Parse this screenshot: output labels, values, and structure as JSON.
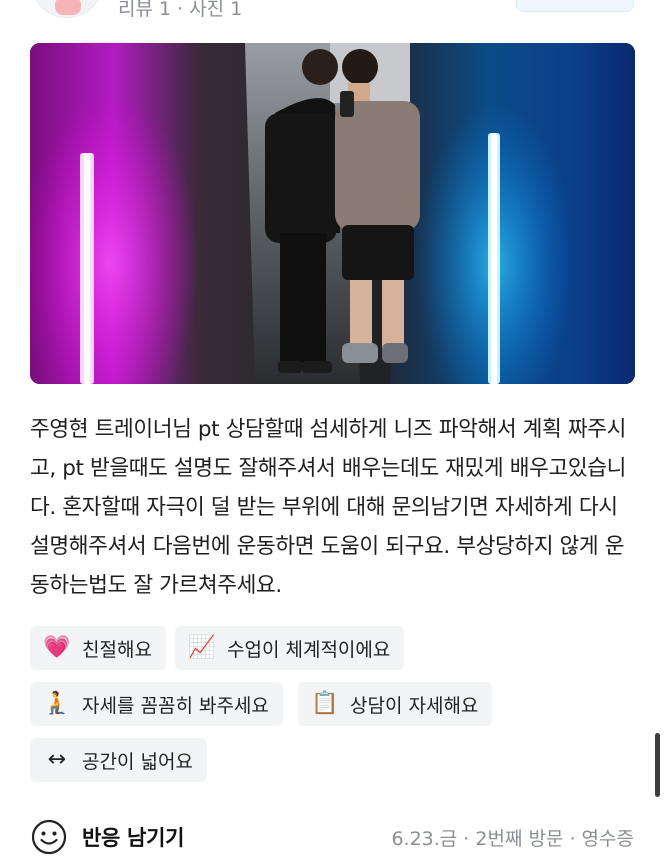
{
  "header": {
    "meta": "리뷰 1 · 사진 1"
  },
  "photo": {
    "alt": "",
    "colors": {
      "left_light": "#e020e0",
      "right_light": "#1aa8ff"
    }
  },
  "review": {
    "text": "주영현 트레이너님 pt 상담할때 섬세하게 니즈 파악해서 계획 짜주시고, pt 받을때도 설명도 잘해주셔서 배우는데도 재밌게 배우고있습니다. 혼자할때 자극이 덜 받는 부위에 대해 문의남기면 자세하게 다시 설명해주셔서 다음번에 운동하면 도움이 되구요. 부상당하지 않게 운동하는법도 잘 가르쳐주세요."
  },
  "tags": [
    {
      "emoji": "💗",
      "icon": "heart-icon",
      "label": "친절해요"
    },
    {
      "emoji": "📈",
      "icon": "chart-icon",
      "label": "수업이 체계적이에요"
    },
    {
      "emoji": "🧎",
      "icon": "kneeling-person-icon",
      "label": "자세를 꼼꼼히 봐주세요"
    },
    {
      "emoji": "📋",
      "icon": "clipboard-icon",
      "label": "상담이 자세해요"
    },
    {
      "emoji": "↔",
      "icon": "left-right-arrow-icon",
      "label": "공간이 넓어요"
    }
  ],
  "footer": {
    "react_label": "반응 남기기",
    "visit_info": "6.23.금 · 2번째 방문 · 영수증"
  }
}
